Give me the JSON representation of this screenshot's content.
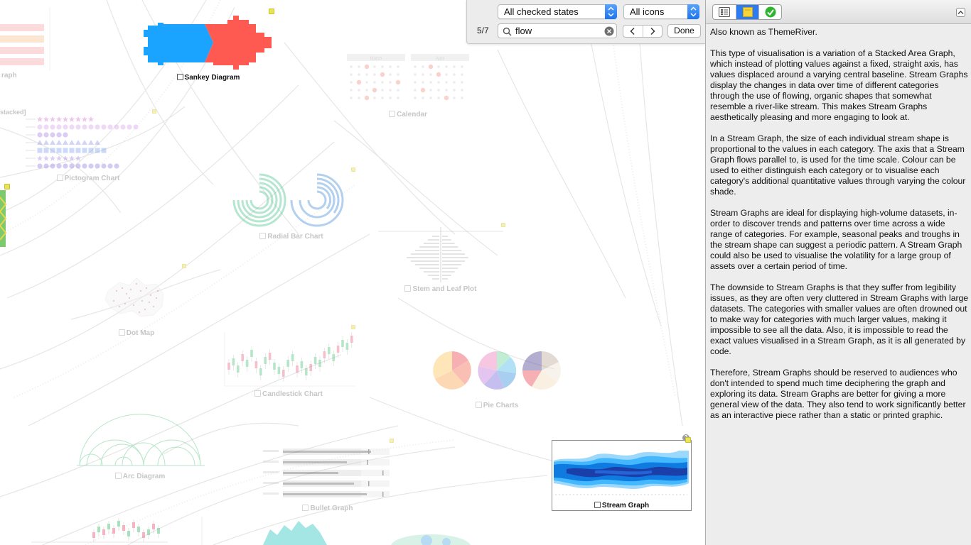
{
  "find_bar": {
    "state_filter": "All checked states",
    "icon_filter": "All icons",
    "match_count": "5/7",
    "search_query": "flow",
    "done_label": "Done"
  },
  "canvas": {
    "nodes": {
      "sankey": "Sankey Diagram",
      "calendar": "Calendar",
      "pictogram": "Pictogram Chart",
      "radial_bar": "Radial Bar Chart",
      "stem_leaf": "Stem and Leaf Plot",
      "dot_map": "Dot Map",
      "candlestick": "Candlestick Chart",
      "pie": "Pie Charts",
      "arc": "Arc Diagram",
      "bullet": "Bullet Graph",
      "stream": "Stream Graph",
      "partial_graph": "raph",
      "partial_stacked": "stacked]"
    },
    "calendar_months": [
      "March",
      "April"
    ],
    "colors": {
      "sankey_left": "#1aa3ff",
      "sankey_right": "#ff5a52",
      "stream_dark": "#1a3fa8",
      "stream_mid": "#0f7ae0",
      "stream_light": "#43b8ff"
    }
  },
  "inspector": {
    "tabs": [
      "properties",
      "notes",
      "status"
    ],
    "selected_tab": "notes",
    "notes": [
      "Also known as ThemeRiver.",
      "This type of visualisation is a variation of a Stacked Area Graph, which instead of plotting values against a fixed, straight axis, has values displaced around a varying central baseline. Stream Graphs display the changes in data over time of different categories through the use of flowing, organic shapes that somewhat resemble a river-like stream. This makes Stream Graphs aesthetically pleasing and more engaging to look at.",
      "In a Stream Graph, the size of each individual stream shape is proportional to the values in each category. The axis that a Stream Graph flows parallel to, is used for the time scale. Colour can be used to either distinguish each category or to visualise each category's additional quantitative values through varying the colour shade.",
      "Stream Graphs are ideal for displaying high-volume datasets, in-order to discover trends and patterns over time across a wide range of categories. For example, seasonal peaks and troughs in the stream shape can suggest a periodic pattern. A Stream Graph could also be used to visualise the volatility for a large group of assets over a certain period of time.",
      "The downside to Stream Graphs is that they suffer from legibility issues, as they are often very cluttered in Stream Graphs with large datasets. The categories with smaller values are often drowned out to make way for categories with much larger values, making it impossible to see all the data. Also, it is impossible to read the exact values visualised in a Stream Graph, as it is all generated by code.",
      "Therefore, Stream Graphs should be reserved to audiences who don't intended to spend much time deciphering the graph and exploring its data. Stream Graphs are better for giving a more general view of the data. They also tend to work significantly better as an interactive piece rather than a static or printed graphic."
    ]
  }
}
